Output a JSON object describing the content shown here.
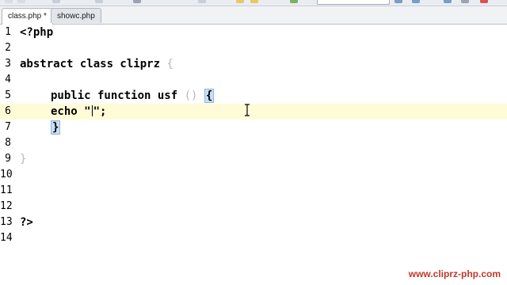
{
  "tabs": [
    {
      "label": "class.php *",
      "active": true
    },
    {
      "label": "showc.php",
      "active": false
    }
  ],
  "editor": {
    "lines": [
      {
        "num": "1",
        "text": "<?php"
      },
      {
        "num": "2",
        "text": ""
      },
      {
        "num": "3",
        "text": "abstract class cliprz",
        "brace": "{"
      },
      {
        "num": "4",
        "text": ""
      },
      {
        "num": "5",
        "text": "public function usf",
        "parens": "()",
        "brace": "{"
      },
      {
        "num": "6",
        "text": "echo \"",
        "after_caret": "\";"
      },
      {
        "num": "7",
        "brace": "}"
      },
      {
        "num": "8",
        "text": ""
      },
      {
        "num": "9",
        "brace": "}"
      },
      {
        "num": "10",
        "text": ""
      },
      {
        "num": "11",
        "text": ""
      },
      {
        "num": "12",
        "text": ""
      },
      {
        "num": "13",
        "text": "?>"
      },
      {
        "num": "14",
        "text": ""
      }
    ],
    "current_line": 6
  },
  "watermark": "www.cliprz-php.com",
  "colors": {
    "current_line_bg": "#fffbd6",
    "brace_match_bg": "#c5e0f7",
    "watermark": "#c0392b"
  }
}
